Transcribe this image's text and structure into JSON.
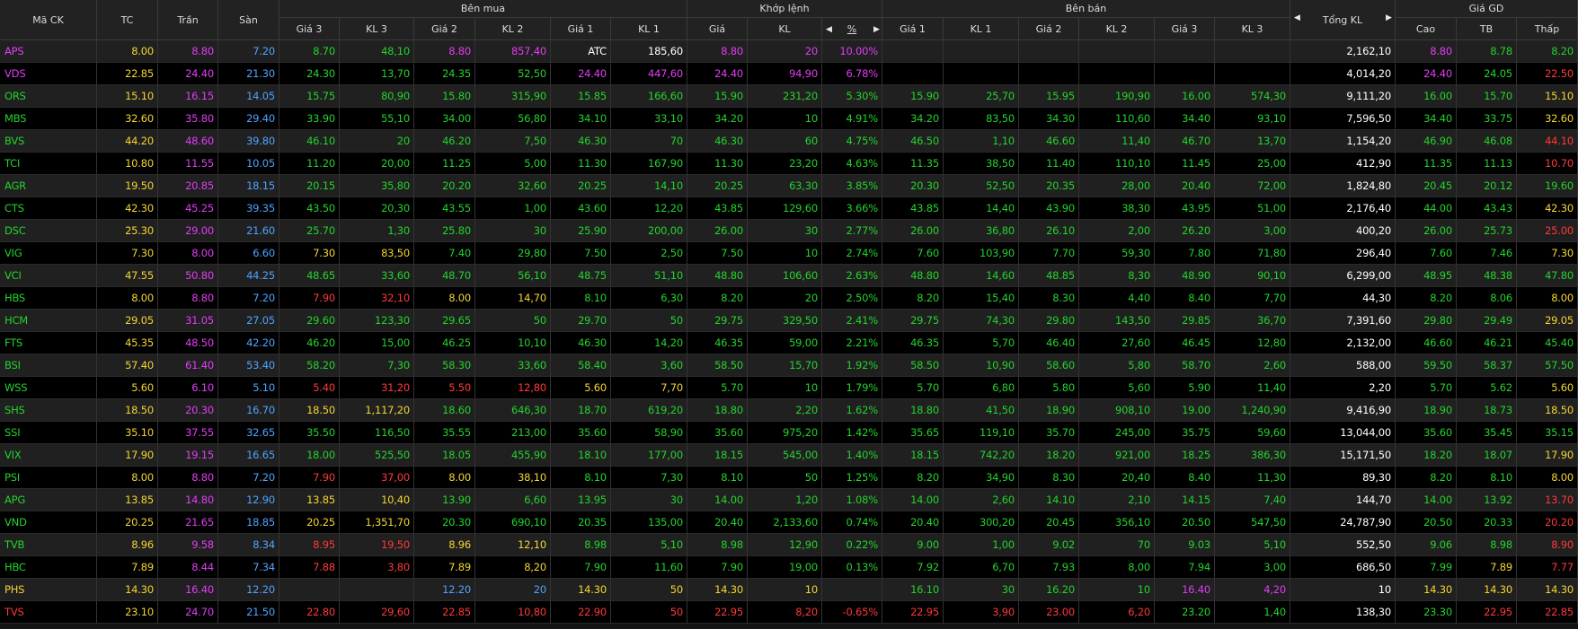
{
  "header": {
    "ma_ck": "Mã CK",
    "tc": "TC",
    "tran": "Trần",
    "san": "Sàn",
    "ben_mua": "Bên mua",
    "khop_lenh": "Khớp lệnh",
    "ben_ban": "Bên bán",
    "tong_kl": "Tổng KL",
    "gia_gd": "Giá GD",
    "gia3": "Giá 3",
    "kl3": "KL 3",
    "gia2": "Giá 2",
    "kl2": "KL 2",
    "gia1": "Giá 1",
    "kl1": "KL 1",
    "khop_gia": "Giá",
    "khop_kl": "KL",
    "khop_pct": "%",
    "cao": "Cao",
    "tb": "TB",
    "thap": "Thấp"
  },
  "colors": {
    "ref": "#f3d530",
    "ceil": "#e23cf5",
    "floor": "#4fa3ff",
    "up": "#23d32b",
    "down": "#ff3838",
    "plain": "#ffffff"
  },
  "rows": [
    {
      "sym": "APS",
      "tc": "8.00",
      "tran": "8.80",
      "san": "7.20",
      "b3": "8.70",
      "bk3": "48,10",
      "b2": "8.80",
      "bk2": "857,40",
      "b1": "ATC",
      "bk1": "185,60",
      "mp": "8.80",
      "mk": "20",
      "pct": "10.00%",
      "s1": "",
      "sk1": "",
      "s2": "",
      "sk2": "",
      "s3": "",
      "sk3": "",
      "tkl": "2,162,10",
      "cao": "8.80",
      "tb": "8.78",
      "thap": "8.20"
    },
    {
      "sym": "VDS",
      "tc": "22.85",
      "tran": "24.40",
      "san": "21.30",
      "b3": "24.30",
      "bk3": "13,70",
      "b2": "24.35",
      "bk2": "52,50",
      "b1": "24.40",
      "bk1": "447,60",
      "mp": "24.40",
      "mk": "94,90",
      "pct": "6.78%",
      "s1": "",
      "sk1": "",
      "s2": "",
      "sk2": "",
      "s3": "",
      "sk3": "",
      "tkl": "4,014,20",
      "cao": "24.40",
      "tb": "24.05",
      "thap": "22.50"
    },
    {
      "sym": "ORS",
      "tc": "15.10",
      "tran": "16.15",
      "san": "14.05",
      "b3": "15.75",
      "bk3": "80,90",
      "b2": "15.80",
      "bk2": "315,90",
      "b1": "15.85",
      "bk1": "166,60",
      "mp": "15.90",
      "mk": "231,20",
      "pct": "5.30%",
      "s1": "15.90",
      "sk1": "25,70",
      "s2": "15.95",
      "sk2": "190,90",
      "s3": "16.00",
      "sk3": "574,30",
      "tkl": "9,111,20",
      "cao": "16.00",
      "tb": "15.70",
      "thap": "15.10"
    },
    {
      "sym": "MBS",
      "tc": "32.60",
      "tran": "35.80",
      "san": "29.40",
      "b3": "33.90",
      "bk3": "55,10",
      "b2": "34.00",
      "bk2": "56,80",
      "b1": "34.10",
      "bk1": "33,10",
      "mp": "34.20",
      "mk": "10",
      "pct": "4.91%",
      "s1": "34.20",
      "sk1": "83,50",
      "s2": "34.30",
      "sk2": "110,60",
      "s3": "34.40",
      "sk3": "93,10",
      "tkl": "7,596,50",
      "cao": "34.40",
      "tb": "33.75",
      "thap": "32.60"
    },
    {
      "sym": "BVS",
      "tc": "44.20",
      "tran": "48.60",
      "san": "39.80",
      "b3": "46.10",
      "bk3": "20",
      "b2": "46.20",
      "bk2": "7,50",
      "b1": "46.30",
      "bk1": "70",
      "mp": "46.30",
      "mk": "60",
      "pct": "4.75%",
      "s1": "46.50",
      "sk1": "1,10",
      "s2": "46.60",
      "sk2": "11,40",
      "s3": "46.70",
      "sk3": "13,70",
      "tkl": "1,154,20",
      "cao": "46.90",
      "tb": "46.08",
      "thap": "44.10"
    },
    {
      "sym": "TCI",
      "tc": "10.80",
      "tran": "11.55",
      "san": "10.05",
      "b3": "11.20",
      "bk3": "20,00",
      "b2": "11.25",
      "bk2": "5,00",
      "b1": "11.30",
      "bk1": "167,90",
      "mp": "11.30",
      "mk": "23,20",
      "pct": "4.63%",
      "s1": "11.35",
      "sk1": "38,50",
      "s2": "11.40",
      "sk2": "110,10",
      "s3": "11.45",
      "sk3": "25,00",
      "tkl": "412,90",
      "cao": "11.35",
      "tb": "11.13",
      "thap": "10.70"
    },
    {
      "sym": "AGR",
      "tc": "19.50",
      "tran": "20.85",
      "san": "18.15",
      "b3": "20.15",
      "bk3": "35,80",
      "b2": "20.20",
      "bk2": "32,60",
      "b1": "20.25",
      "bk1": "14,10",
      "mp": "20.25",
      "mk": "63,30",
      "pct": "3.85%",
      "s1": "20.30",
      "sk1": "52,50",
      "s2": "20.35",
      "sk2": "28,00",
      "s3": "20.40",
      "sk3": "72,00",
      "tkl": "1,824,80",
      "cao": "20.45",
      "tb": "20.12",
      "thap": "19.60"
    },
    {
      "sym": "CTS",
      "tc": "42.30",
      "tran": "45.25",
      "san": "39.35",
      "b3": "43.50",
      "bk3": "20,30",
      "b2": "43.55",
      "bk2": "1,00",
      "b1": "43.60",
      "bk1": "12,20",
      "mp": "43.85",
      "mk": "129,60",
      "pct": "3.66%",
      "s1": "43.85",
      "sk1": "14,40",
      "s2": "43.90",
      "sk2": "38,30",
      "s3": "43.95",
      "sk3": "51,00",
      "tkl": "2,176,40",
      "cao": "44.00",
      "tb": "43.43",
      "thap": "42.30"
    },
    {
      "sym": "DSC",
      "tc": "25.30",
      "tran": "29.00",
      "san": "21.60",
      "b3": "25.70",
      "bk3": "1,30",
      "b2": "25.80",
      "bk2": "30",
      "b1": "25.90",
      "bk1": "200,00",
      "mp": "26.00",
      "mk": "30",
      "pct": "2.77%",
      "s1": "26.00",
      "sk1": "36,80",
      "s2": "26.10",
      "sk2": "2,00",
      "s3": "26.20",
      "sk3": "3,00",
      "tkl": "400,20",
      "cao": "26.00",
      "tb": "25.73",
      "thap": "25.00"
    },
    {
      "sym": "VIG",
      "tc": "7.30",
      "tran": "8.00",
      "san": "6.60",
      "b3": "7.30",
      "bk3": "83,50",
      "b2": "7.40",
      "bk2": "29,80",
      "b1": "7.50",
      "bk1": "2,50",
      "mp": "7.50",
      "mk": "10",
      "pct": "2.74%",
      "s1": "7.60",
      "sk1": "103,90",
      "s2": "7.70",
      "sk2": "59,30",
      "s3": "7.80",
      "sk3": "71,80",
      "tkl": "296,40",
      "cao": "7.60",
      "tb": "7.46",
      "thap": "7.30"
    },
    {
      "sym": "VCI",
      "tc": "47.55",
      "tran": "50.80",
      "san": "44.25",
      "b3": "48.65",
      "bk3": "33,60",
      "b2": "48.70",
      "bk2": "56,10",
      "b1": "48.75",
      "bk1": "51,10",
      "mp": "48.80",
      "mk": "106,60",
      "pct": "2.63%",
      "s1": "48.80",
      "sk1": "14,60",
      "s2": "48.85",
      "sk2": "8,30",
      "s3": "48.90",
      "sk3": "90,10",
      "tkl": "6,299,00",
      "cao": "48.95",
      "tb": "48.38",
      "thap": "47.80"
    },
    {
      "sym": "HBS",
      "tc": "8.00",
      "tran": "8.80",
      "san": "7.20",
      "b3": "7.90",
      "bk3": "32,10",
      "b2": "8.00",
      "bk2": "14,70",
      "b1": "8.10",
      "bk1": "6,30",
      "mp": "8.20",
      "mk": "20",
      "pct": "2.50%",
      "s1": "8.20",
      "sk1": "15,40",
      "s2": "8.30",
      "sk2": "4,40",
      "s3": "8.40",
      "sk3": "7,70",
      "tkl": "44,30",
      "cao": "8.20",
      "tb": "8.06",
      "thap": "8.00"
    },
    {
      "sym": "HCM",
      "tc": "29.05",
      "tran": "31.05",
      "san": "27.05",
      "b3": "29.60",
      "bk3": "123,30",
      "b2": "29.65",
      "bk2": "50",
      "b1": "29.70",
      "bk1": "50",
      "mp": "29.75",
      "mk": "329,50",
      "pct": "2.41%",
      "s1": "29.75",
      "sk1": "74,30",
      "s2": "29.80",
      "sk2": "143,50",
      "s3": "29.85",
      "sk3": "36,70",
      "tkl": "7,391,60",
      "cao": "29.80",
      "tb": "29.49",
      "thap": "29.05"
    },
    {
      "sym": "FTS",
      "tc": "45.35",
      "tran": "48.50",
      "san": "42.20",
      "b3": "46.20",
      "bk3": "15,00",
      "b2": "46.25",
      "bk2": "10,10",
      "b1": "46.30",
      "bk1": "14,20",
      "mp": "46.35",
      "mk": "59,00",
      "pct": "2.21%",
      "s1": "46.35",
      "sk1": "5,70",
      "s2": "46.40",
      "sk2": "27,60",
      "s3": "46.45",
      "sk3": "12,80",
      "tkl": "2,132,00",
      "cao": "46.60",
      "tb": "46.21",
      "thap": "45.40"
    },
    {
      "sym": "BSI",
      "tc": "57.40",
      "tran": "61.40",
      "san": "53.40",
      "b3": "58.20",
      "bk3": "7,30",
      "b2": "58.30",
      "bk2": "33,60",
      "b1": "58.40",
      "bk1": "3,60",
      "mp": "58.50",
      "mk": "15,70",
      "pct": "1.92%",
      "s1": "58.50",
      "sk1": "10,90",
      "s2": "58.60",
      "sk2": "5,80",
      "s3": "58.70",
      "sk3": "2,60",
      "tkl": "588,00",
      "cao": "59.50",
      "tb": "58.37",
      "thap": "57.50"
    },
    {
      "sym": "WSS",
      "tc": "5.60",
      "tran": "6.10",
      "san": "5.10",
      "b3": "5.40",
      "bk3": "31,20",
      "b2": "5.50",
      "bk2": "12,80",
      "b1": "5.60",
      "bk1": "7,70",
      "mp": "5.70",
      "mk": "10",
      "pct": "1.79%",
      "s1": "5.70",
      "sk1": "6,80",
      "s2": "5.80",
      "sk2": "5,60",
      "s3": "5.90",
      "sk3": "11,40",
      "tkl": "2,20",
      "cao": "5.70",
      "tb": "5.62",
      "thap": "5.60"
    },
    {
      "sym": "SHS",
      "tc": "18.50",
      "tran": "20.30",
      "san": "16.70",
      "b3": "18.50",
      "bk3": "1,117,20",
      "b2": "18.60",
      "bk2": "646,30",
      "b1": "18.70",
      "bk1": "619,20",
      "mp": "18.80",
      "mk": "2,20",
      "pct": "1.62%",
      "s1": "18.80",
      "sk1": "41,50",
      "s2": "18.90",
      "sk2": "908,10",
      "s3": "19.00",
      "sk3": "1,240,90",
      "tkl": "9,416,90",
      "cao": "18.90",
      "tb": "18.73",
      "thap": "18.50"
    },
    {
      "sym": "SSI",
      "tc": "35.10",
      "tran": "37.55",
      "san": "32.65",
      "b3": "35.50",
      "bk3": "116,50",
      "b2": "35.55",
      "bk2": "213,00",
      "b1": "35.60",
      "bk1": "58,90",
      "mp": "35.60",
      "mk": "975,20",
      "pct": "1.42%",
      "s1": "35.65",
      "sk1": "119,10",
      "s2": "35.70",
      "sk2": "245,00",
      "s3": "35.75",
      "sk3": "59,60",
      "tkl": "13,044,00",
      "cao": "35.60",
      "tb": "35.45",
      "thap": "35.15"
    },
    {
      "sym": "VIX",
      "tc": "17.90",
      "tran": "19.15",
      "san": "16.65",
      "b3": "18.00",
      "bk3": "525,50",
      "b2": "18.05",
      "bk2": "455,90",
      "b1": "18.10",
      "bk1": "177,00",
      "mp": "18.15",
      "mk": "545,00",
      "pct": "1.40%",
      "s1": "18.15",
      "sk1": "742,20",
      "s2": "18.20",
      "sk2": "921,00",
      "s3": "18.25",
      "sk3": "386,30",
      "tkl": "15,171,50",
      "cao": "18.20",
      "tb": "18.07",
      "thap": "17.90"
    },
    {
      "sym": "PSI",
      "tc": "8.00",
      "tran": "8.80",
      "san": "7.20",
      "b3": "7.90",
      "bk3": "37,00",
      "b2": "8.00",
      "bk2": "38,10",
      "b1": "8.10",
      "bk1": "7,30",
      "mp": "8.10",
      "mk": "50",
      "pct": "1.25%",
      "s1": "8.20",
      "sk1": "34,90",
      "s2": "8.30",
      "sk2": "20,40",
      "s3": "8.40",
      "sk3": "11,30",
      "tkl": "89,30",
      "cao": "8.20",
      "tb": "8.10",
      "thap": "8.00"
    },
    {
      "sym": "APG",
      "tc": "13.85",
      "tran": "14.80",
      "san": "12.90",
      "b3": "13.85",
      "bk3": "10,40",
      "b2": "13.90",
      "bk2": "6,60",
      "b1": "13.95",
      "bk1": "30",
      "mp": "14.00",
      "mk": "1,20",
      "pct": "1.08%",
      "s1": "14.00",
      "sk1": "2,60",
      "s2": "14.10",
      "sk2": "2,10",
      "s3": "14.15",
      "sk3": "7,40",
      "tkl": "144,70",
      "cao": "14.00",
      "tb": "13.92",
      "thap": "13.70"
    },
    {
      "sym": "VND",
      "tc": "20.25",
      "tran": "21.65",
      "san": "18.85",
      "b3": "20.25",
      "bk3": "1,351,70",
      "b2": "20.30",
      "bk2": "690,10",
      "b1": "20.35",
      "bk1": "135,00",
      "mp": "20.40",
      "mk": "2,133,60",
      "pct": "0.74%",
      "s1": "20.40",
      "sk1": "300,20",
      "s2": "20.45",
      "sk2": "356,10",
      "s3": "20.50",
      "sk3": "547,50",
      "tkl": "24,787,90",
      "cao": "20.50",
      "tb": "20.33",
      "thap": "20.20"
    },
    {
      "sym": "TVB",
      "tc": "8.96",
      "tran": "9.58",
      "san": "8.34",
      "b3": "8.95",
      "bk3": "19,50",
      "b2": "8.96",
      "bk2": "12,10",
      "b1": "8.98",
      "bk1": "5,10",
      "mp": "8.98",
      "mk": "12,90",
      "pct": "0.22%",
      "s1": "9.00",
      "sk1": "1,00",
      "s2": "9.02",
      "sk2": "70",
      "s3": "9.03",
      "sk3": "5,10",
      "tkl": "552,50",
      "cao": "9.06",
      "tb": "8.98",
      "thap": "8.90"
    },
    {
      "sym": "HBC",
      "tc": "7.89",
      "tran": "8.44",
      "san": "7.34",
      "b3": "7.88",
      "bk3": "3,80",
      "b2": "7.89",
      "bk2": "8,20",
      "b1": "7.90",
      "bk1": "11,60",
      "mp": "7.90",
      "mk": "19,00",
      "pct": "0.13%",
      "s1": "7.92",
      "sk1": "6,70",
      "s2": "7.93",
      "sk2": "8,00",
      "s3": "7.94",
      "sk3": "3,00",
      "tkl": "686,50",
      "cao": "7.99",
      "tb": "7.89",
      "thap": "7.77"
    },
    {
      "sym": "PHS",
      "tc": "14.30",
      "tran": "16.40",
      "san": "12.20",
      "b3": "",
      "bk3": "",
      "b2": "12.20",
      "bk2": "20",
      "b1": "14.30",
      "bk1": "50",
      "mp": "14.30",
      "mk": "10",
      "pct": "",
      "s1": "16.10",
      "sk1": "30",
      "s2": "16.20",
      "sk2": "10",
      "s3": "16.40",
      "sk3": "4,20",
      "tkl": "10",
      "cao": "14.30",
      "tb": "14.30",
      "thap": "14.30"
    },
    {
      "sym": "TVS",
      "tc": "23.10",
      "tran": "24.70",
      "san": "21.50",
      "b3": "22.80",
      "bk3": "29,60",
      "b2": "22.85",
      "bk2": "10,80",
      "b1": "22.90",
      "bk1": "50",
      "mp": "22.95",
      "mk": "8,20",
      "pct": "-0.65%",
      "s1": "22.95",
      "sk1": "3,90",
      "s2": "23.00",
      "sk2": "6,20",
      "s3": "23.20",
      "sk3": "1,40",
      "tkl": "138,30",
      "cao": "23.30",
      "tb": "22.95",
      "thap": "22.85"
    }
  ]
}
